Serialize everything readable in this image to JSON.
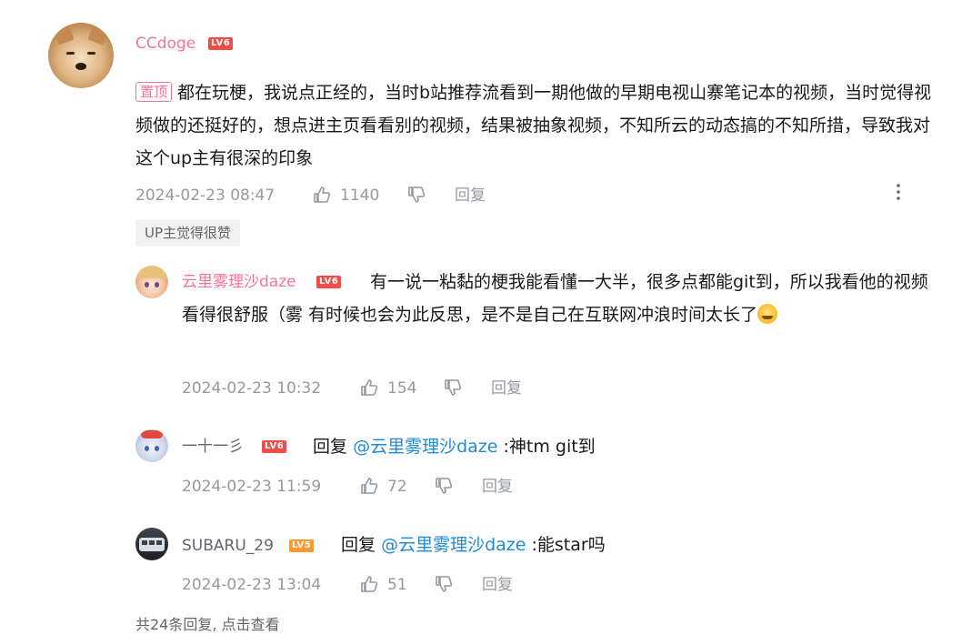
{
  "main_comment": {
    "username": "CCdoge",
    "level": "LV6",
    "pin_label": "置顶",
    "text": "都在玩梗，我说点正经的，当时b站推荐流看到一期他做的早期电视山寨笔记本的视频，当时觉得视频做的还挺好的，想点进主页看看别的视频，结果被抽象视频，不知所云的动态搞的不知所措，导致我对这个up主有很深的印象",
    "time": "2024-02-23 08:47",
    "likes": "1140",
    "reply_label": "回复",
    "up_like_tag": "UP主觉得很赞"
  },
  "replies": [
    {
      "username": "云里雾理沙daze",
      "level": "LV6",
      "text": "有一说一粘黏的梗我能看懂一大半，很多点都能git到，所以我看他的视频看得很舒服（雾  有时候也会为此反思，是不是自己在互联网冲浪时间太长了",
      "time": "2024-02-23 10:32",
      "likes": "154",
      "reply_label": "回复"
    },
    {
      "username": "一十一彡",
      "level": "LV6",
      "reply_prefix": "回复",
      "mention": "@云里雾理沙daze",
      "text": ":神tm git到",
      "time": "2024-02-23 11:59",
      "likes": "72",
      "reply_label": "回复"
    },
    {
      "username": "SUBARU_29",
      "level": "LV5",
      "reply_prefix": "回复",
      "mention": "@云里雾理沙daze",
      "text": ":能star吗",
      "time": "2024-02-23 13:04",
      "likes": "51",
      "reply_label": "回复"
    }
  ],
  "see_all_replies": "共24条回复, 点击查看",
  "colors": {
    "username_pink": "#fb7299",
    "mention_blue": "#1f8bd6",
    "meta_gray": "#9499a0",
    "level6": "#f04c49",
    "level5": "#ff9a33"
  },
  "icons": [
    "thumbs-up-icon",
    "thumbs-down-icon",
    "more-vertical-icon",
    "emoji-icon"
  ]
}
